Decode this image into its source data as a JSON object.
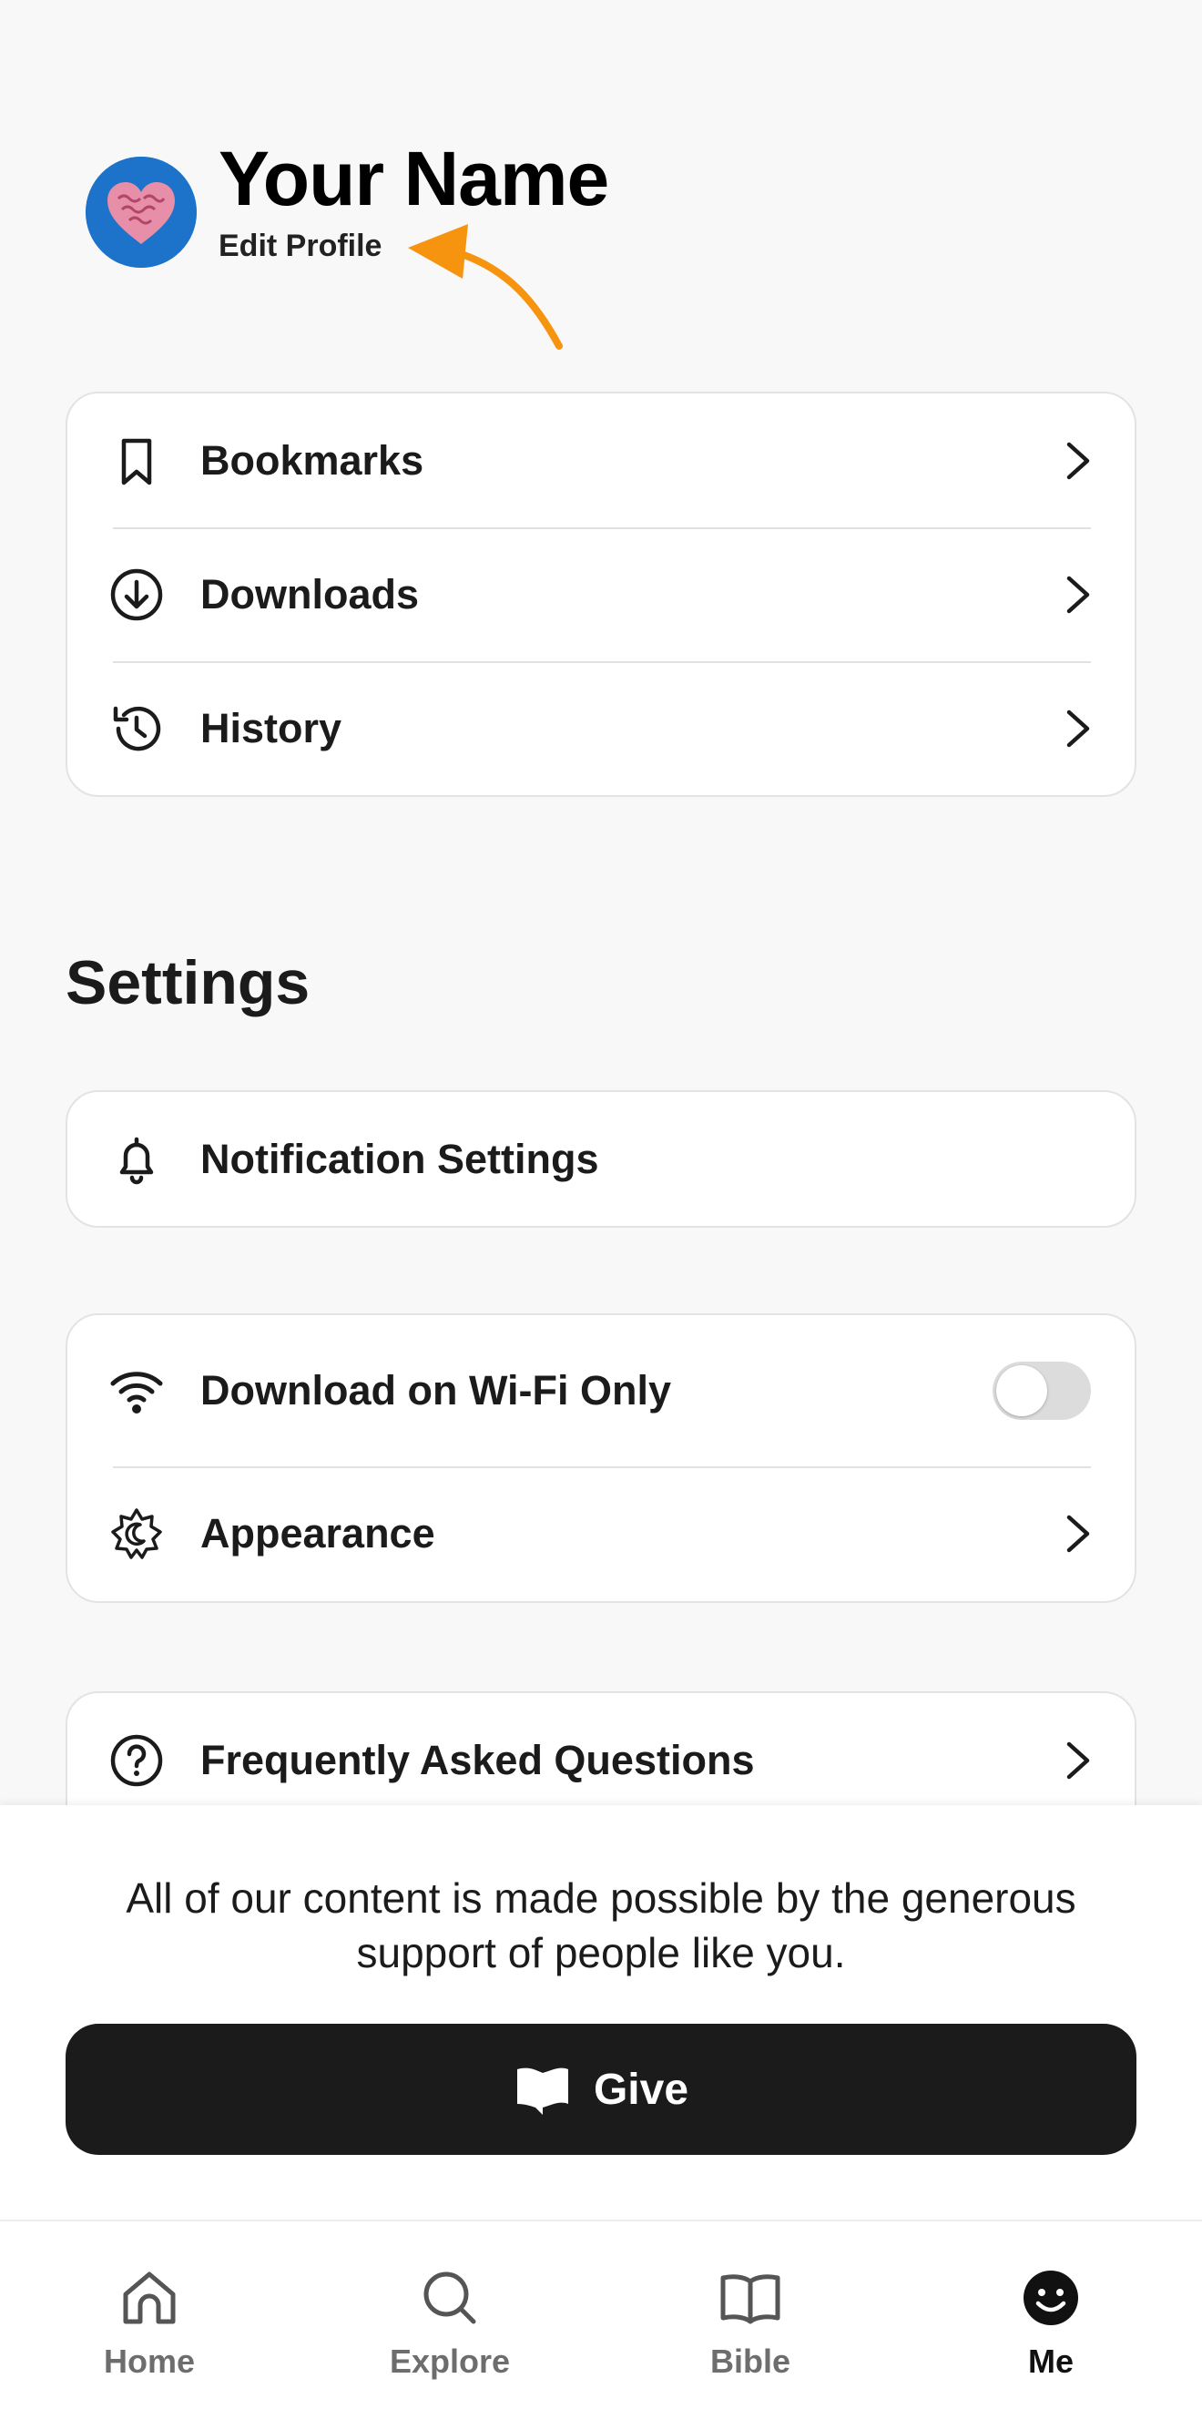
{
  "profile": {
    "name": "Your Name",
    "edit_label": "Edit Profile"
  },
  "library_list": [
    {
      "label": "Bookmarks",
      "icon": "bookmark-icon"
    },
    {
      "label": "Downloads",
      "icon": "download-icon"
    },
    {
      "label": "History",
      "icon": "history-icon"
    }
  ],
  "settings": {
    "title": "Settings",
    "notifications_label": "Notification Settings",
    "wifi_label": "Download on Wi-Fi Only",
    "wifi_only_enabled": false,
    "appearance_label": "Appearance",
    "faq_label": "Frequently Asked Questions"
  },
  "give": {
    "message": "All of our content is made possible by the generous support of people like you.",
    "button_label": "Give",
    "button_icon": "flag-icon"
  },
  "bottom_nav": [
    {
      "label": "Home",
      "icon": "home-icon",
      "active": false
    },
    {
      "label": "Explore",
      "icon": "search-icon",
      "active": false
    },
    {
      "label": "Bible",
      "icon": "book-icon",
      "active": false
    },
    {
      "label": "Me",
      "icon": "smiley-icon",
      "active": true
    }
  ],
  "colors": {
    "background": "#f8f8f8",
    "card": "#ffffff",
    "text": "#1b1b1b",
    "give_button": "#1b1b1b",
    "avatar_bg": "#1c73c9",
    "annotation_arrow": "#f7940f",
    "toggle_off": "#dcdcdc"
  }
}
